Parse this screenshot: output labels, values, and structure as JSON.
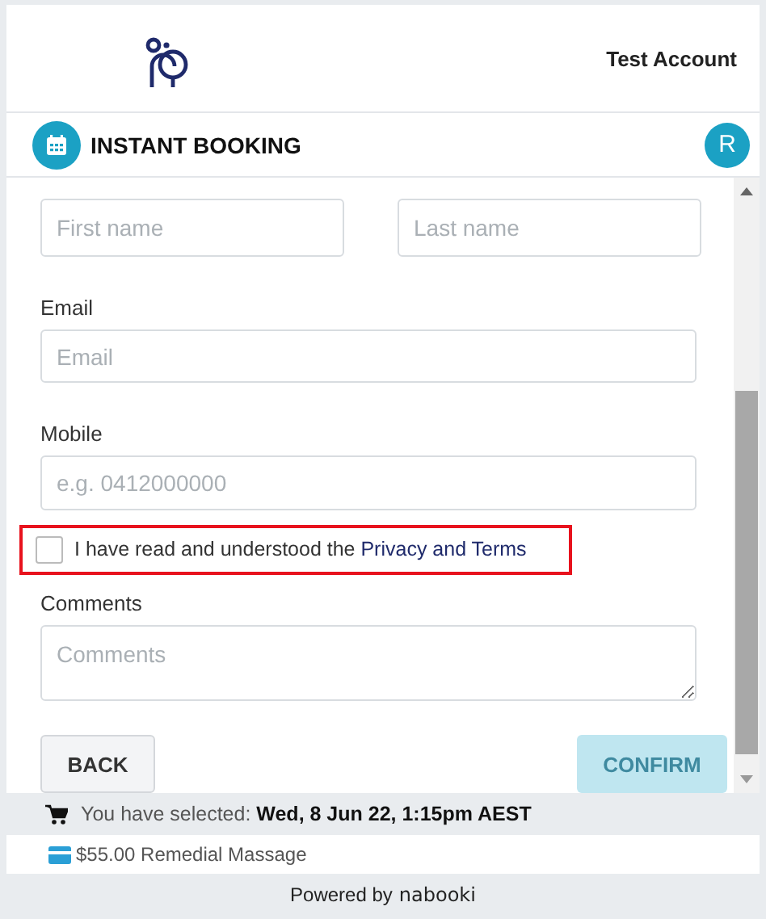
{
  "header": {
    "account": "Test Account"
  },
  "booking_bar": {
    "title": "INSTANT BOOKING",
    "avatar": "R"
  },
  "form": {
    "name_fields": [
      {
        "placeholder": "First name"
      },
      {
        "placeholder": "Last name"
      }
    ],
    "fields": [
      {
        "label": "Email",
        "placeholder": "Email"
      },
      {
        "label": "Mobile",
        "placeholder": "e.g. 0412000000"
      }
    ],
    "consent": {
      "text": "I have read and understood the ",
      "link": "Privacy and Terms",
      "checked": false,
      "highlighted": true
    },
    "comments": {
      "label": "Comments",
      "placeholder": "Comments"
    }
  },
  "buttons": [
    {
      "label": "BACK",
      "kind": "secondary",
      "disabled": false
    },
    {
      "label": "CONFIRM",
      "kind": "primary",
      "disabled": true
    }
  ],
  "summary": {
    "prefix": "You have selected: ",
    "value": "Wed, 8 Jun 22, 1:15pm AEST"
  },
  "service": "$55.00 Remedial Massage",
  "footer": {
    "powered": "Powered by",
    "brand": "nabooki"
  }
}
